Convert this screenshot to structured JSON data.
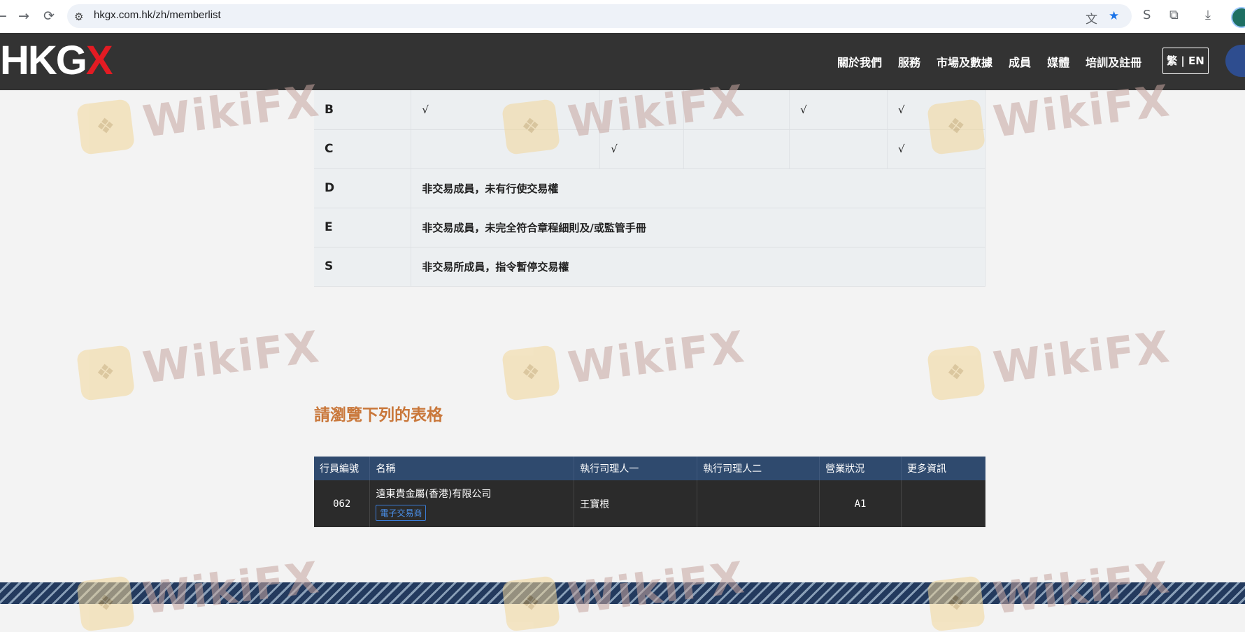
{
  "browser": {
    "back_icon": "←",
    "forward_icon": "→",
    "reload_icon": "⟳",
    "site_info_icon": "⚙",
    "url": "hkgx.com.hk/zh/memberlist",
    "translate_icon": "文",
    "star_icon": "★",
    "tool_icons": [
      "S",
      "⧉",
      "⤓"
    ]
  },
  "header": {
    "logo_text": "HKG",
    "logo_accent": "X",
    "nav": [
      "關於我們",
      "服務",
      "市場及數據",
      "成員",
      "媒體",
      "培訓及註冊"
    ],
    "lang_switch": "繁 | EN"
  },
  "class_table": {
    "rows": [
      {
        "class": "B",
        "type": "ticks",
        "cells": [
          "√",
          "",
          "",
          "√",
          "√"
        ]
      },
      {
        "class": "C",
        "type": "ticks",
        "cells": [
          "",
          "√",
          "",
          "",
          "√"
        ]
      },
      {
        "class": "D",
        "type": "desc",
        "desc": "非交易成員，未有行使交易權"
      },
      {
        "class": "E",
        "type": "desc",
        "desc": "非交易成員，未完全符合章程細則及/或監管手冊"
      },
      {
        "class": "S",
        "type": "desc",
        "desc": "非交易所成員，指令暫停交易權"
      }
    ]
  },
  "section_heading": "請瀏覽下列的表格",
  "member_table": {
    "headers": [
      "行員編號",
      "名稱",
      "執行司理人一",
      "執行司理人二",
      "營業狀況",
      "更多資訊"
    ],
    "rows": [
      {
        "id": "062",
        "name": "遠東貴金屬(香港)有限公司",
        "tag": "電子交易商",
        "manager1": "王寶根",
        "manager2": "",
        "status": "A1",
        "more": ""
      }
    ]
  },
  "watermark": {
    "text": "WikiFX",
    "icon": "eagle-icon"
  },
  "colors": {
    "header_bg": "#333333",
    "heading_accent": "#c9773a",
    "table_header_bg": "#2f4a6e",
    "table_row_bg": "#2b2b2b",
    "logo_red": "#e31b23"
  }
}
